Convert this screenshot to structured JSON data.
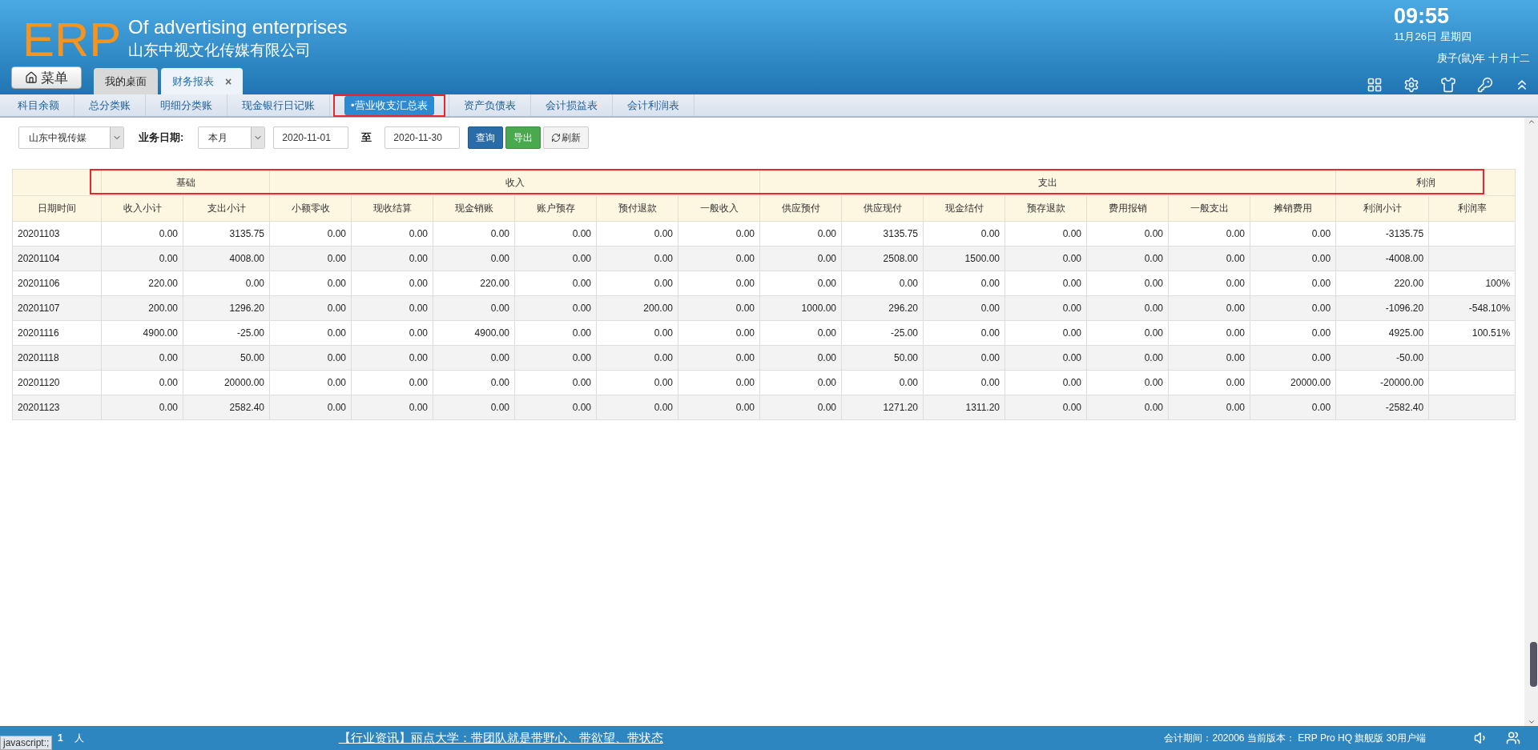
{
  "header": {
    "logo": "ERP",
    "title": "Of advertising enterprises",
    "company": "山东中视文化传媒有限公司",
    "time": "09:55",
    "date": "11月26日 星期四",
    "lunar": "庚子(鼠)年 十月十二"
  },
  "menu_button": "菜单",
  "window_tabs": [
    {
      "label": "我的桌面",
      "selected": false
    },
    {
      "label": "财务报表",
      "selected": true,
      "close": "×"
    }
  ],
  "report_tabs": [
    {
      "label": "科目余额",
      "selected": false,
      "highlighted": false
    },
    {
      "label": "总分类账",
      "selected": false,
      "highlighted": false
    },
    {
      "label": "明细分类账",
      "selected": false,
      "highlighted": false
    },
    {
      "label": "现金银行日记账",
      "selected": false,
      "highlighted": false
    },
    {
      "label": "•营业收支汇总表",
      "selected": true,
      "highlighted": true
    },
    {
      "label": "资产负债表",
      "selected": false,
      "highlighted": false
    },
    {
      "label": "会计损益表",
      "selected": false,
      "highlighted": false
    },
    {
      "label": "会计利润表",
      "selected": false,
      "highlighted": false
    }
  ],
  "filters": {
    "company": "山东中视传媒",
    "date_label": "业务日期:",
    "period": "本月",
    "from": "2020-11-01",
    "to_label": "至",
    "to": "2020-11-30",
    "buttons": [
      {
        "label": "查询",
        "kind": "primary"
      },
      {
        "label": "导出",
        "kind": "success"
      },
      {
        "label": "刷新",
        "kind": "refresh"
      }
    ]
  },
  "table": {
    "groups_highlighted": true,
    "date_column": "日期时间",
    "groups": [
      {
        "label": "基础",
        "columns": [
          "收入小计",
          "支出小计"
        ]
      },
      {
        "label": "收入",
        "columns": [
          "小额零收",
          "现收结算",
          "现金销账",
          "账户预存",
          "预付退款",
          "一般收入"
        ]
      },
      {
        "label": "支出",
        "columns": [
          "供应预付",
          "供应现付",
          "现金结付",
          "预存退款",
          "费用报销",
          "一般支出",
          "摊销费用"
        ]
      },
      {
        "label": "利润",
        "columns": [
          "利润小计",
          "利润率"
        ]
      }
    ],
    "rows": [
      [
        "20201103",
        "0.00",
        "3135.75",
        "0.00",
        "0.00",
        "0.00",
        "0.00",
        "0.00",
        "0.00",
        "0.00",
        "3135.75",
        "0.00",
        "0.00",
        "0.00",
        "0.00",
        "0.00",
        "-3135.75"
      ],
      [
        "20201104",
        "0.00",
        "4008.00",
        "0.00",
        "0.00",
        "0.00",
        "0.00",
        "0.00",
        "0.00",
        "0.00",
        "2508.00",
        "1500.00",
        "0.00",
        "0.00",
        "0.00",
        "0.00",
        "-4008.00"
      ],
      [
        "20201106",
        "220.00",
        "0.00",
        "0.00",
        "0.00",
        "220.00",
        "0.00",
        "0.00",
        "0.00",
        "0.00",
        "0.00",
        "0.00",
        "0.00",
        "0.00",
        "0.00",
        "0.00",
        "220.00",
        "100%"
      ],
      [
        "20201107",
        "200.00",
        "1296.20",
        "0.00",
        "0.00",
        "0.00",
        "0.00",
        "200.00",
        "0.00",
        "1000.00",
        "296.20",
        "0.00",
        "0.00",
        "0.00",
        "0.00",
        "0.00",
        "-1096.20",
        "-548.10%"
      ],
      [
        "20201116",
        "4900.00",
        "-25.00",
        "0.00",
        "0.00",
        "4900.00",
        "0.00",
        "0.00",
        "0.00",
        "0.00",
        "-25.00",
        "0.00",
        "0.00",
        "0.00",
        "0.00",
        "0.00",
        "4925.00",
        "100.51%"
      ],
      [
        "20201118",
        "0.00",
        "50.00",
        "0.00",
        "0.00",
        "0.00",
        "0.00",
        "0.00",
        "0.00",
        "0.00",
        "50.00",
        "0.00",
        "0.00",
        "0.00",
        "0.00",
        "0.00",
        "-50.00"
      ],
      [
        "20201120",
        "0.00",
        "20000.00",
        "0.00",
        "0.00",
        "0.00",
        "0.00",
        "0.00",
        "0.00",
        "0.00",
        "0.00",
        "0.00",
        "0.00",
        "0.00",
        "0.00",
        "20000.00",
        "-20000.00"
      ],
      [
        "20201123",
        "0.00",
        "2582.40",
        "0.00",
        "0.00",
        "0.00",
        "0.00",
        "0.00",
        "0.00",
        "0.00",
        "1271.20",
        "1311.20",
        "0.00",
        "0.00",
        "0.00",
        "0.00",
        "-2582.40"
      ]
    ]
  },
  "status_bar": {
    "browser_status": "javascript:;",
    "online_count": "1",
    "online_unit": "人",
    "news": "【行业资讯】丽点大学：带团队就是带野心、带欲望、带状态",
    "info": "会计期间：202006 当前版本： ERP Pro HQ 旗舰版 30用户端"
  }
}
